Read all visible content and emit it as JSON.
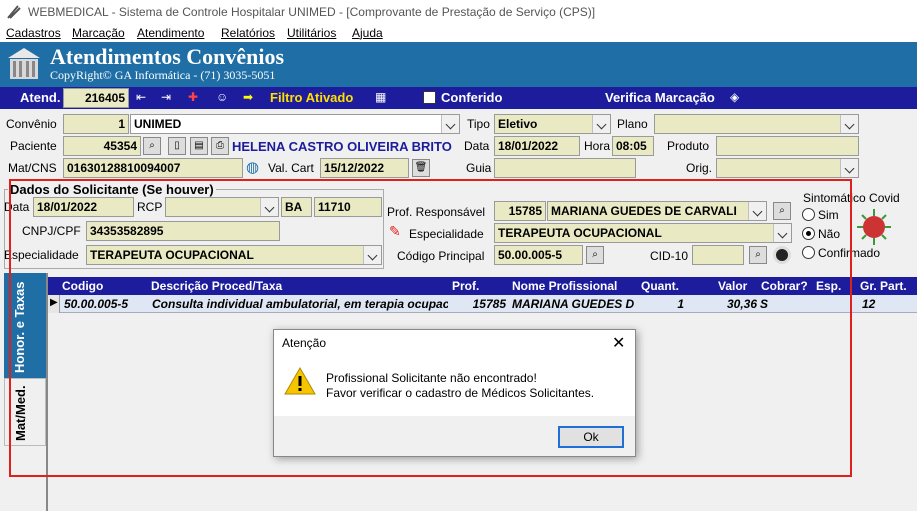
{
  "window": {
    "title": "WEBMEDICAL - Sistema de Controle Hospitalar UNIMED - [Comprovante de Prestação de Serviço  (CPS)]"
  },
  "menu": [
    "Cadastros",
    "Marcação",
    "Atendimento",
    "Relatórios",
    "Utilitários",
    "Ajuda"
  ],
  "banner": {
    "title": "Atendimentos Convênios",
    "copyright": "CopyRight© GA Informática - (71) 3035-5051"
  },
  "toolbar": {
    "atend_label": "Atend.",
    "atend_value": "216405",
    "filtro": "Filtro Ativado",
    "conferido": "Conferido",
    "verifica": "Verifica Marcação"
  },
  "form": {
    "convenio_label": "Convênio",
    "convenio_code": "1",
    "convenio_name": "UNIMED",
    "tipo_label": "Tipo",
    "tipo_value": "Eletivo",
    "plano_label": "Plano",
    "plano_value": "",
    "paciente_label": "Paciente",
    "paciente_code": "45354",
    "paciente_name": "HELENA CASTRO OLIVEIRA BRITO",
    "data_label": "Data",
    "data_value": "18/01/2022",
    "hora_label": "Hora",
    "hora_value": "08:05",
    "produto_label": "Produto",
    "produto_value": "",
    "matcns_label": "Mat/CNS",
    "matcns_value": "01630128810094007",
    "valcart_label": "Val. Cart",
    "valcart_value": "15/12/2022",
    "guia_label": "Guia",
    "guia_value": "",
    "orig_label": "Orig.",
    "orig_value": ""
  },
  "solicitante": {
    "group_title": "Dados do Solicitante (Se houver)",
    "data_label": "Data",
    "data_value": "18/01/2022",
    "rcp_label": "RCP",
    "rcp_value": "",
    "uf_value": "BA",
    "num_value": "11710",
    "cnpj_label": "CNPJ/CPF",
    "cnpj_value": "34353582895",
    "especialidade_label": "Especialidade",
    "especialidade_value": "TERAPEUTA OCUPACIONAL",
    "prof_resp_label": "Prof. Responsável",
    "prof_resp_code": "15785",
    "prof_resp_name": "MARIANA GUEDES DE CARVALI",
    "esp2_label": "Especialidade",
    "esp2_value": "TERAPEUTA OCUPACIONAL",
    "codigo_label": "Código Principal",
    "codigo_value": "50.00.005-5",
    "cid_label": "CID-10",
    "cid_value": ""
  },
  "sintomatico": {
    "title": "Sintomático Covid",
    "options": [
      "Sim",
      "Não",
      "Confirmado"
    ],
    "selected": "Não"
  },
  "tabs": [
    "Honor. e Taxas",
    "Mat/Med."
  ],
  "grid": {
    "headers": [
      "Codigo",
      "Descrição Proced/Taxa",
      "Prof.",
      "Nome Profissional",
      "Quant.",
      "Valor",
      "Cobrar?",
      "Esp.",
      "Gr. Part."
    ],
    "rows": [
      [
        "50.00.005-5",
        "Consulta individual ambulatorial, em terapia ocupaci",
        "15785",
        "MARIANA GUEDES D",
        "1",
        "30,36",
        "S",
        "",
        "12"
      ]
    ]
  },
  "dialog": {
    "title": "Atenção",
    "line1": "Profissional Solicitante não encontrado!",
    "line2": "Favor verificar o cadastro de Médicos Solicitantes.",
    "ok": "Ok"
  },
  "colors": {
    "banner": "#1f6fa6",
    "toolbar": "#1c1c9c",
    "field": "#e9e9c4",
    "highlight_border": "#e0201c"
  }
}
